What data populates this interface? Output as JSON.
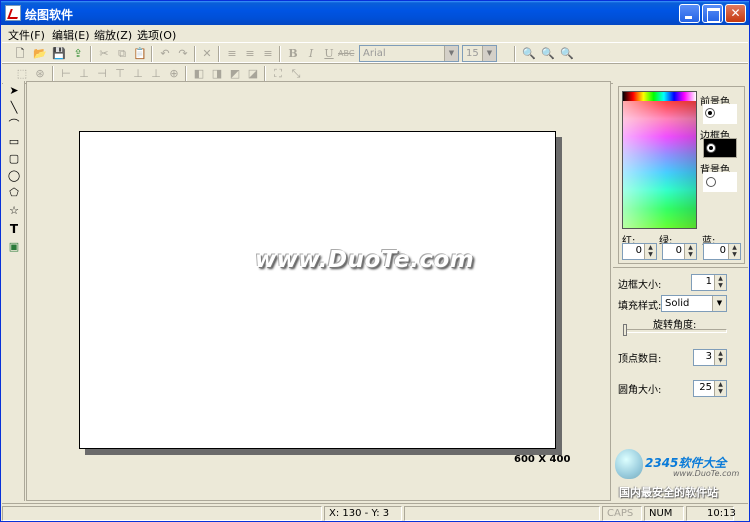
{
  "window": {
    "title": "绘图软件"
  },
  "menu": [
    {
      "label": "文件(F)"
    },
    {
      "label": "编辑(E)"
    },
    {
      "label": "缩放(Z)"
    },
    {
      "label": "选项(O)"
    }
  ],
  "toolbar": {
    "font_value": "Arial",
    "size_value": "15",
    "bold": "B",
    "italic": "I",
    "underline": "U",
    "strike": "ABC"
  },
  "tools": [
    {
      "name": "select-tool-icon",
      "glyph": "➤"
    },
    {
      "name": "line-tool-icon",
      "glyph": "╲"
    },
    {
      "name": "curve-tool-icon",
      "glyph": "⌒"
    },
    {
      "name": "rectangle-tool-icon",
      "glyph": "▭"
    },
    {
      "name": "rounded-rect-tool-icon",
      "glyph": "▢"
    },
    {
      "name": "ellipse-tool-icon",
      "glyph": "◯"
    },
    {
      "name": "polygon-tool-icon",
      "glyph": "⬠"
    },
    {
      "name": "star-tool-icon",
      "glyph": "☆"
    },
    {
      "name": "text-tool-icon",
      "glyph": "T"
    },
    {
      "name": "image-tool-icon",
      "glyph": "▣"
    }
  ],
  "canvas": {
    "watermark": "www.DuoTe.com",
    "size_label": "600 X 400"
  },
  "colors": {
    "foreground_label": "前景色",
    "border_label": "边框色",
    "background_label": "背景色",
    "red_label": "红:",
    "green_label": "绿:",
    "blue_label": "蓝:",
    "red_value": "0",
    "green_value": "0",
    "blue_value": "0",
    "foreground_swatch": "#ffffff",
    "border_swatch": "#000000",
    "background_swatch": "#ffffff"
  },
  "properties": {
    "border_size_label": "边框大小:",
    "border_size_value": "1",
    "fill_style_label": "填充样式:",
    "fill_style_value": "Solid",
    "rotation_label": "旋转角度:",
    "vertex_count_label": "顶点数目:",
    "vertex_count_value": "3",
    "corner_size_label": "圆角大小:",
    "corner_size_value": "25"
  },
  "logo": {
    "brand": "2345软件大全",
    "url": "www.DuoTe.com",
    "slogan": "国内最安全的软件站"
  },
  "status": {
    "coords": "X: 130 - Y: 3",
    "caps": "CAPS",
    "num": "NUM",
    "time": "10:13"
  }
}
